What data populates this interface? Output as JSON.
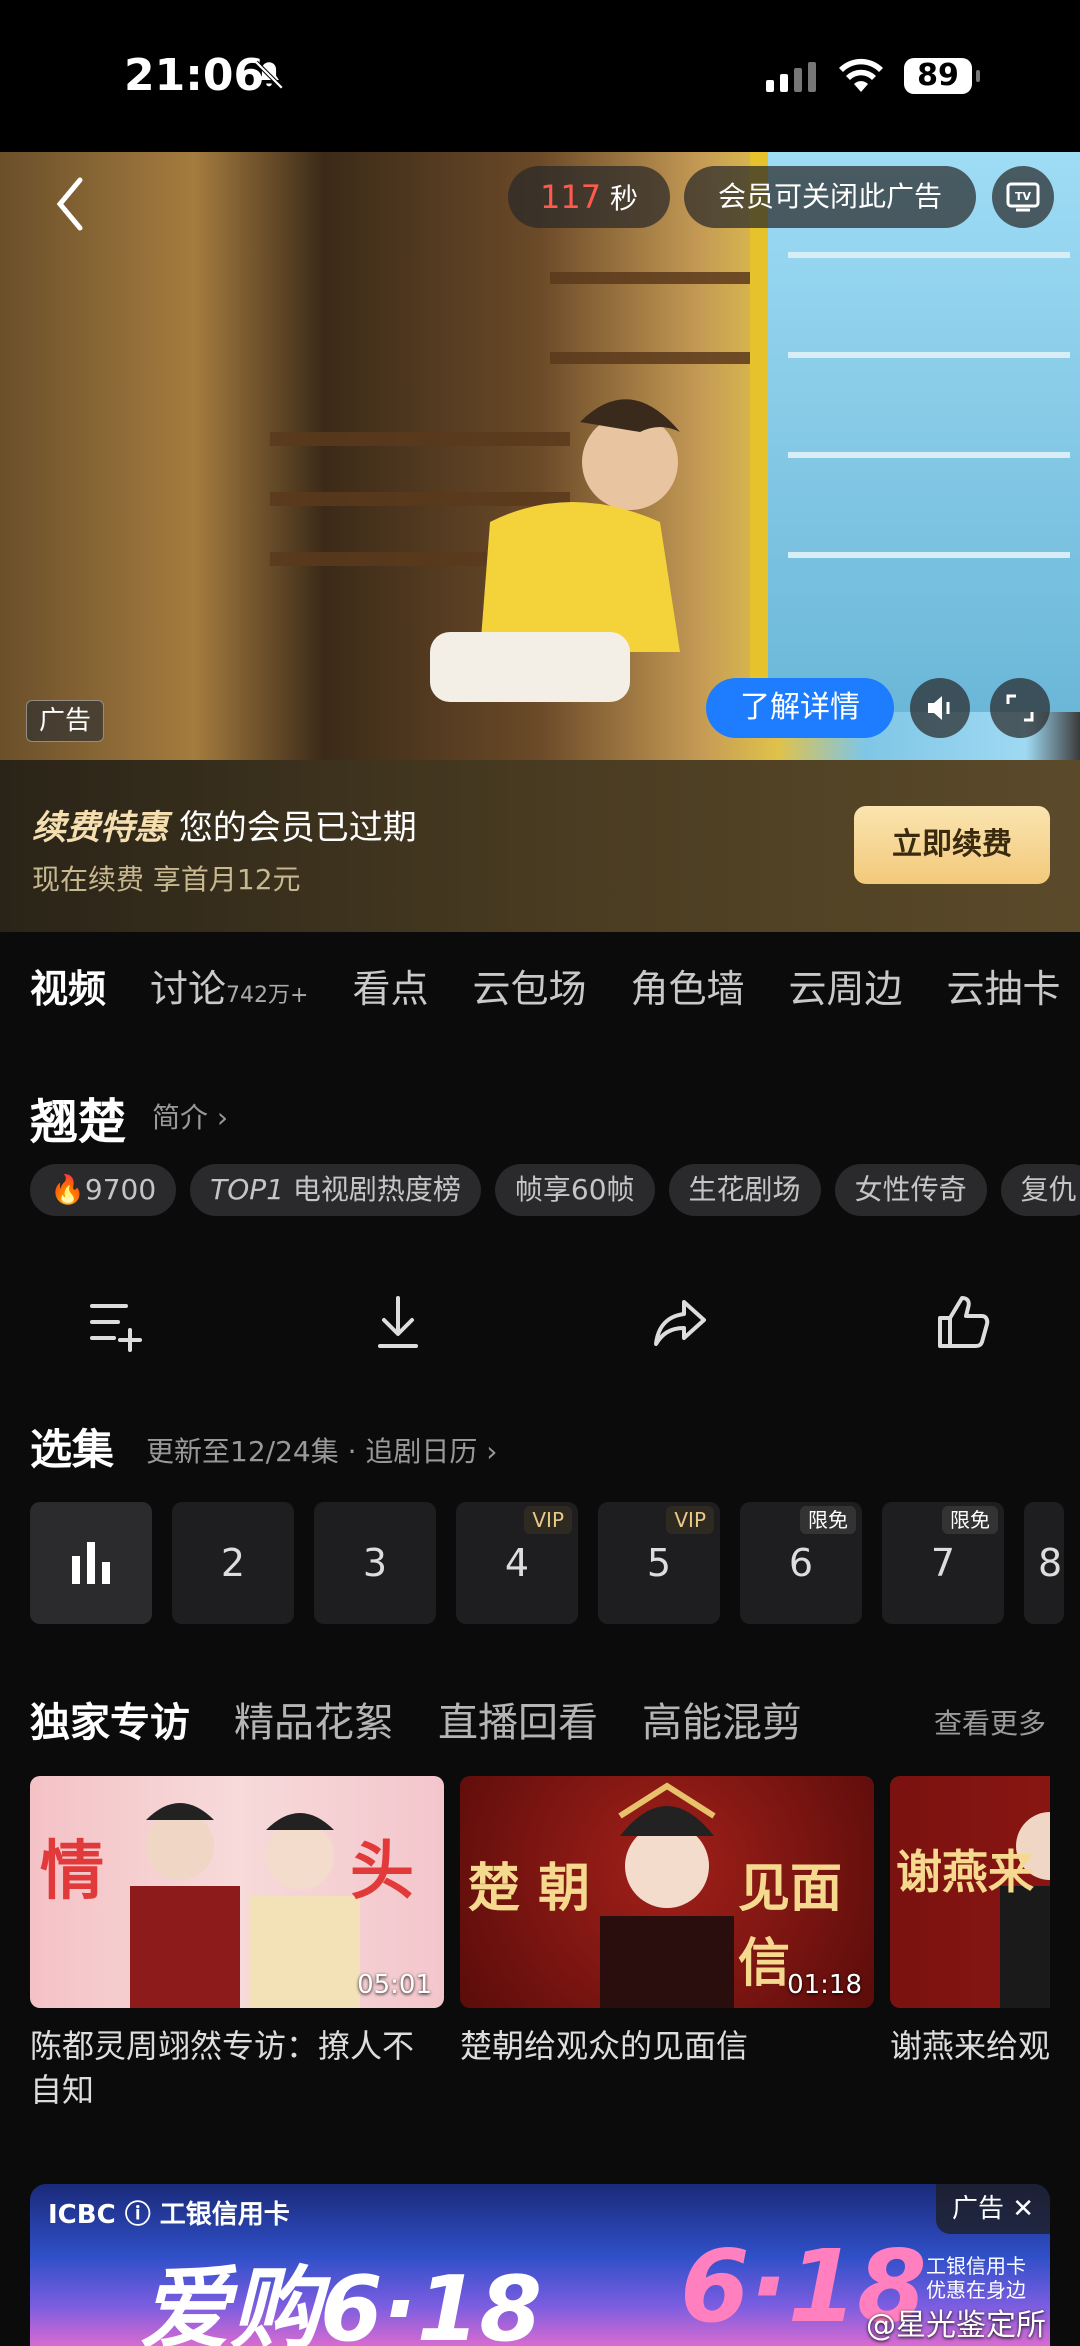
{
  "status_bar": {
    "time": "21:06",
    "battery": "89"
  },
  "ad_video": {
    "countdown_value": "117",
    "countdown_unit": "秒",
    "close_hint": "会员可关闭此广告",
    "tv_label": "TV",
    "ad_tag": "广告",
    "learn_more": "了解详情"
  },
  "renew": {
    "title_bold": "续费特惠",
    "title_rest": "您的会员已过期",
    "subtitle": "现在续费 享首月12元",
    "button": "立即续费"
  },
  "tabs": [
    {
      "label": "视频",
      "badge": ""
    },
    {
      "label": "讨论",
      "badge": "742万+"
    },
    {
      "label": "看点",
      "badge": ""
    },
    {
      "label": "云包场",
      "badge": ""
    },
    {
      "label": "角色墙",
      "badge": ""
    },
    {
      "label": "云周边",
      "badge": ""
    },
    {
      "label": "云抽卡",
      "badge": ""
    }
  ],
  "show": {
    "title": "翘楚",
    "intro_link": "简介 ›",
    "chips": [
      "9700",
      "TOP1",
      "电视剧热度榜",
      "帧享60帧",
      "生花剧场",
      "女性传奇",
      "复仇"
    ]
  },
  "actions": [
    "add-to-list-icon",
    "download-icon",
    "share-icon",
    "like-icon"
  ],
  "episodes": {
    "title": "选集",
    "subtitle": "更新至12/24集 · 追剧日历 ›",
    "items": [
      {
        "num": "",
        "tag": ""
      },
      {
        "num": "2",
        "tag": ""
      },
      {
        "num": "3",
        "tag": ""
      },
      {
        "num": "4",
        "tag": "VIP"
      },
      {
        "num": "5",
        "tag": "VIP"
      },
      {
        "num": "6",
        "tag": "限免"
      },
      {
        "num": "7",
        "tag": "限免"
      },
      {
        "num": "8",
        "tag": ""
      }
    ]
  },
  "exclusive": {
    "tabs": [
      "独家专访",
      "精品花絮",
      "直播回看",
      "高能混剪"
    ],
    "more": "查看更多",
    "cards": [
      {
        "title": "陈都灵周翊然专访：撩人不自知",
        "duration": "05:01",
        "art_text_left": "情",
        "art_text_right": "头"
      },
      {
        "title": "楚朝给观众的见面信",
        "duration": "01:18",
        "art_text_left": "楚 朝",
        "art_text_right": "见面信"
      },
      {
        "title": "谢燕来给观众的",
        "duration": "",
        "art_text_left": "谢燕来",
        "art_text_right": ""
      }
    ]
  },
  "bottom_ad": {
    "brand": "ICBC ⓘ 工银信用卡",
    "badge": "广告 ✕",
    "promo_left": "爱购6·18",
    "promo_right": "6·18",
    "slogan_line1": "工银信用卡",
    "slogan_line2": "优惠在身边"
  },
  "watermark": "@星光鉴定所"
}
